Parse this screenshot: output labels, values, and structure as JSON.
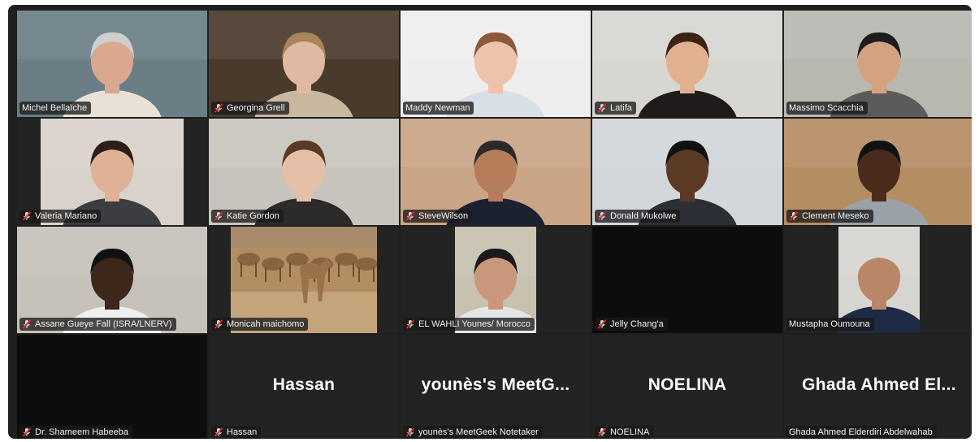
{
  "meeting": {
    "tiles": [
      {
        "name": "Michel Bellaïche",
        "muted": false,
        "video": "person",
        "bg": "#6b7e86",
        "skin": "#d9a88e",
        "shirt": "#e8e1d6",
        "hair": "#cfcfcf"
      },
      {
        "name": "Georgina Grell",
        "muted": true,
        "video": "person",
        "bg": "#4a3a2c",
        "skin": "#e0b9a2",
        "shirt": "#c9b8a0",
        "hair": "#a8865a"
      },
      {
        "name": "Maddy Newman",
        "muted": false,
        "video": "person",
        "active": true,
        "bg": "#eeeeee",
        "skin": "#edc3ac",
        "shirt": "#d9dfe6",
        "hair": "#8c5a38"
      },
      {
        "name": "Latifa",
        "muted": true,
        "video": "person",
        "bg": "#d8d6d3",
        "skin": "#e1b18f",
        "shirt": "#1f1b1b",
        "hair": "#3a2416"
      },
      {
        "name": "Massimo Scacchia",
        "muted": false,
        "video": "person",
        "bg": "#b8b7b0",
        "skin": "#d4a27f",
        "shirt": "#5b5b5b",
        "hair": "#1d1d1d"
      },
      {
        "name": "Valeria Mariano",
        "muted": true,
        "video": "person",
        "narrow": true,
        "bg": "#d8d2ca",
        "skin": "#dfb197",
        "shirt": "#3c3d40",
        "hair": "#2c1f17"
      },
      {
        "name": "Katie Gordon",
        "muted": true,
        "video": "person",
        "bg": "#c8c4bd",
        "skin": "#e6bfa9",
        "shirt": "#2d2a2a",
        "hair": "#5a3a26"
      },
      {
        "name": "SteveWilson",
        "muted": true,
        "video": "person",
        "bg": "#c9a485",
        "skin": "#b67d5a",
        "shirt": "#1b2130",
        "hair": "#2a2a2a"
      },
      {
        "name": "Donald Mukolwe",
        "muted": true,
        "video": "person",
        "bg": "#d3d6da",
        "skin": "#5b3a26",
        "shirt": "#2c2f36",
        "hair": "#111111"
      },
      {
        "name": "Clement Meseko",
        "muted": true,
        "video": "person",
        "bg": "#b58d63",
        "skin": "#4a2c1c",
        "shirt": "#9aa1a9",
        "hair": "#111111"
      },
      {
        "name": "Assane Gueye Fall (ISRA/LNERV)",
        "muted": true,
        "video": "person",
        "bg": "#c6c2ba",
        "skin": "#3d261a",
        "shirt": "#f0f0f0",
        "hair": "#111111"
      },
      {
        "name": "Monicah maichomo",
        "muted": true,
        "video": "camels",
        "wide": true,
        "bg": "#b28d62"
      },
      {
        "name": "EL WAHLI Younes/ Morocco",
        "muted": true,
        "video": "person",
        "small": true,
        "bg": "#c7c1b0",
        "skin": "#c99779",
        "shirt": "#e6e6e6",
        "hair": "#1b1b1b"
      },
      {
        "name": "Jelly Chang'a",
        "muted": true,
        "video": "black"
      },
      {
        "name": "Mustapha Oumouna",
        "muted": false,
        "video": "person",
        "small": true,
        "bg": "#d6d5d1",
        "skin": "#b98668",
        "shirt": "#1f2a44",
        "hair": "#d8d8d8"
      },
      {
        "name": "Dr. Shameem Habeeba",
        "muted": true,
        "video": "black"
      },
      {
        "name": "Hassan",
        "muted": true,
        "video": "none",
        "display": "Hassan"
      },
      {
        "name": "younès's MeetGeek Notetaker",
        "muted": true,
        "video": "none",
        "display": "younès's  MeetG..."
      },
      {
        "name": "NOELINA",
        "muted": true,
        "video": "none",
        "display": "NOELINA"
      },
      {
        "name": "Ghada Ahmed Elderdiri Abdelwahab",
        "muted": false,
        "video": "none",
        "display": "Ghada  Ahmed  El..."
      }
    ]
  },
  "colors": {
    "muted_icon": "#e02b2b",
    "active_border": "#2ed573"
  },
  "icons": {
    "muted": "mic-muted-icon"
  }
}
